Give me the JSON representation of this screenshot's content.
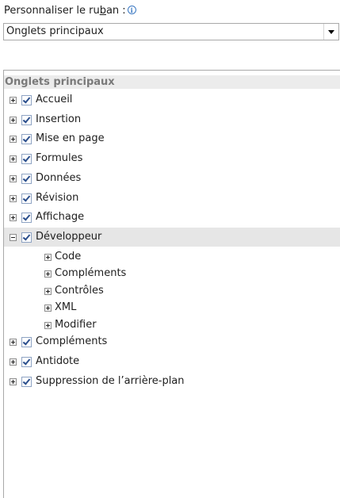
{
  "header": {
    "label_pre": "Personnaliser le ru",
    "label_u": "b",
    "label_post": "an :",
    "info_glyph": "i"
  },
  "dropdown": {
    "value": "Onglets principaux"
  },
  "tree": {
    "title": "Onglets principaux",
    "items": [
      {
        "label": "Accueil",
        "level": 1,
        "expanded": false,
        "checked": true
      },
      {
        "label": "Insertion",
        "level": 1,
        "expanded": false,
        "checked": true
      },
      {
        "label": "Mise en page",
        "level": 1,
        "expanded": false,
        "checked": true
      },
      {
        "label": "Formules",
        "level": 1,
        "expanded": false,
        "checked": true
      },
      {
        "label": "Données",
        "level": 1,
        "expanded": false,
        "checked": true
      },
      {
        "label": "Révision",
        "level": 1,
        "expanded": false,
        "checked": true
      },
      {
        "label": "Affichage",
        "level": 1,
        "expanded": false,
        "checked": true
      },
      {
        "label": "Développeur",
        "level": 1,
        "expanded": true,
        "checked": true,
        "selected": true
      },
      {
        "label": "Code",
        "level": 2,
        "expanded": false
      },
      {
        "label": "Compléments",
        "level": 2,
        "expanded": false
      },
      {
        "label": "Contrôles",
        "level": 2,
        "expanded": false
      },
      {
        "label": "XML",
        "level": 2,
        "expanded": false
      },
      {
        "label": "Modifier",
        "level": 2,
        "expanded": false
      },
      {
        "label": "Compléments",
        "level": 1,
        "expanded": false,
        "checked": true
      },
      {
        "label": "Antidote",
        "level": 1,
        "expanded": false,
        "checked": true
      },
      {
        "label": "Suppression de l’arrière-plan",
        "level": 1,
        "expanded": false,
        "checked": true
      }
    ]
  }
}
